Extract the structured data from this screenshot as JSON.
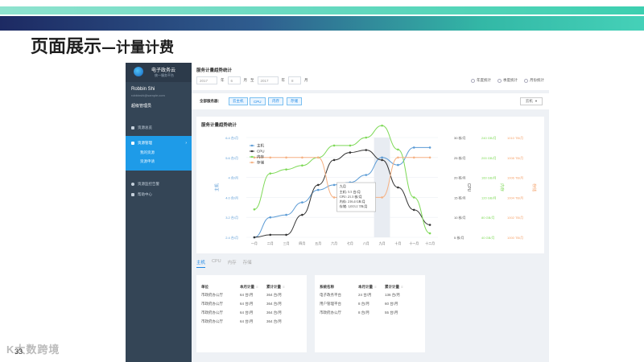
{
  "slide": {
    "title_main": "页面展示",
    "title_sub": "—计量计费",
    "page_number": "33",
    "footer_logo": "K大数跨境"
  },
  "app": {
    "logo_name": "电子政务云",
    "logo_sub": "统一服务平台",
    "user_name": "Robbin Shi",
    "user_email": "robbinshi@sample.com",
    "user_role": "超级管理员",
    "nav": [
      {
        "label": "资源总览"
      },
      {
        "label": "资源管理",
        "active": true,
        "children": [
          "我的资源",
          "资源申请"
        ]
      },
      {
        "label": "资源监控告警"
      },
      {
        "label": "帮助中心"
      }
    ]
  },
  "header": {
    "title": "服务计量趋势统计",
    "year_start": "2017",
    "year_unit": "年",
    "month_start": "6",
    "month_unit": "月",
    "to": "至",
    "year_end": "2017",
    "month_end": "8",
    "radio_options": [
      "年度统计",
      "季度统计",
      "月份统计"
    ]
  },
  "filter": {
    "label": "全部服务器：",
    "chips": [
      "云主机",
      "CPU",
      "内存",
      "存储"
    ],
    "select_label": "云机"
  },
  "chart_data": {
    "type": "line",
    "title": "服务计量趋势统计",
    "categories": [
      "一月",
      "二月",
      "三月",
      "四月",
      "五月",
      "六月",
      "七月",
      "八月",
      "九月",
      "十月",
      "十一月",
      "十二月"
    ],
    "series": [
      {
        "name": "主机",
        "color": "#5b9bd5",
        "axis": "y1",
        "values": [
          2.4,
          3.2,
          3.3,
          3.8,
          4.3,
          4.5,
          4.6,
          4.9,
          5.6,
          5.3,
          6.0,
          6.0
        ]
      },
      {
        "name": "CPU",
        "color": "#333333",
        "axis": "y1",
        "values": [
          2.4,
          2.5,
          2.5,
          3.3,
          4.5,
          5.5,
          5.8,
          5.9,
          5.5,
          4.4,
          3.5,
          2.9
        ]
      },
      {
        "name": "内存",
        "color": "#7ed957",
        "axis": "y2",
        "values": [
          12,
          21,
          22,
          23,
          25,
          28,
          28,
          30,
          33,
          27,
          15,
          6
        ]
      },
      {
        "name": "存储",
        "color": "#f5b183",
        "axis": "y4",
        "values": [
          1008,
          1008,
          1008,
          1008,
          1008,
          1004,
          1004,
          1004,
          1004,
          1008,
          1008,
          1008
        ]
      }
    ],
    "y1": {
      "label": "主机",
      "unit": "台/月",
      "ticks": [
        "2.4 台/月",
        "3.2 台/月",
        "4.0 台/月",
        "4 台/月",
        "5.6 台/月",
        "6.4 台/月"
      ]
    },
    "y2": {
      "label": "CPU",
      "ticks": [
        "5 核/月",
        "10 核/月",
        "15 核/月",
        "20 核/月",
        "25 核/月",
        "30 核/月"
      ]
    },
    "y3": {
      "label": "内存",
      "ticks": [
        "40 GB/月",
        "80 GB/月",
        "120 GB/月",
        "160 GB/月",
        "200 GB/月",
        "240 GB/月"
      ]
    },
    "y4": {
      "label": "存储",
      "ticks": [
        "1000 TB/月",
        "1002 TB/月",
        "1004 TB/月",
        "1006 TB/月",
        "1008 TB/月",
        "1010 TB/月"
      ]
    },
    "legend": [
      "主机",
      "CPU",
      "内存",
      "存储"
    ],
    "tooltip": {
      "title": "九月",
      "lines": [
        "主机: 5.5 台/月",
        "CPU: 21.3 核/月",
        "内存: 216.4 GB/月",
        "存储: 1,013.1 TB/月"
      ]
    }
  },
  "tabs": [
    "主机",
    "CPU",
    "内存",
    "存储"
  ],
  "table1": {
    "headers": [
      "单位",
      "本月计量",
      "累计计量"
    ],
    "rows": [
      [
        "市政府办公厅",
        "64 台/月",
        "364 台/月"
      ],
      [
        "市政府办公厅",
        "64 台/月",
        "364 台/月"
      ],
      [
        "市政府办公厅",
        "64 台/月",
        "364 台/月"
      ],
      [
        "市政府办公厅",
        "64 台/月",
        "364 台/月"
      ]
    ]
  },
  "table2": {
    "headers": [
      "系统名称",
      "本月计量",
      "累计计量"
    ],
    "rows": [
      [
        "电子政务平台",
        "24 台/月",
        "136 台/月"
      ],
      [
        "用户管理平台",
        "8 台/月",
        "60 台/月"
      ],
      [
        "市政府办公厅",
        "8 台/月",
        "55 台/月"
      ]
    ]
  }
}
